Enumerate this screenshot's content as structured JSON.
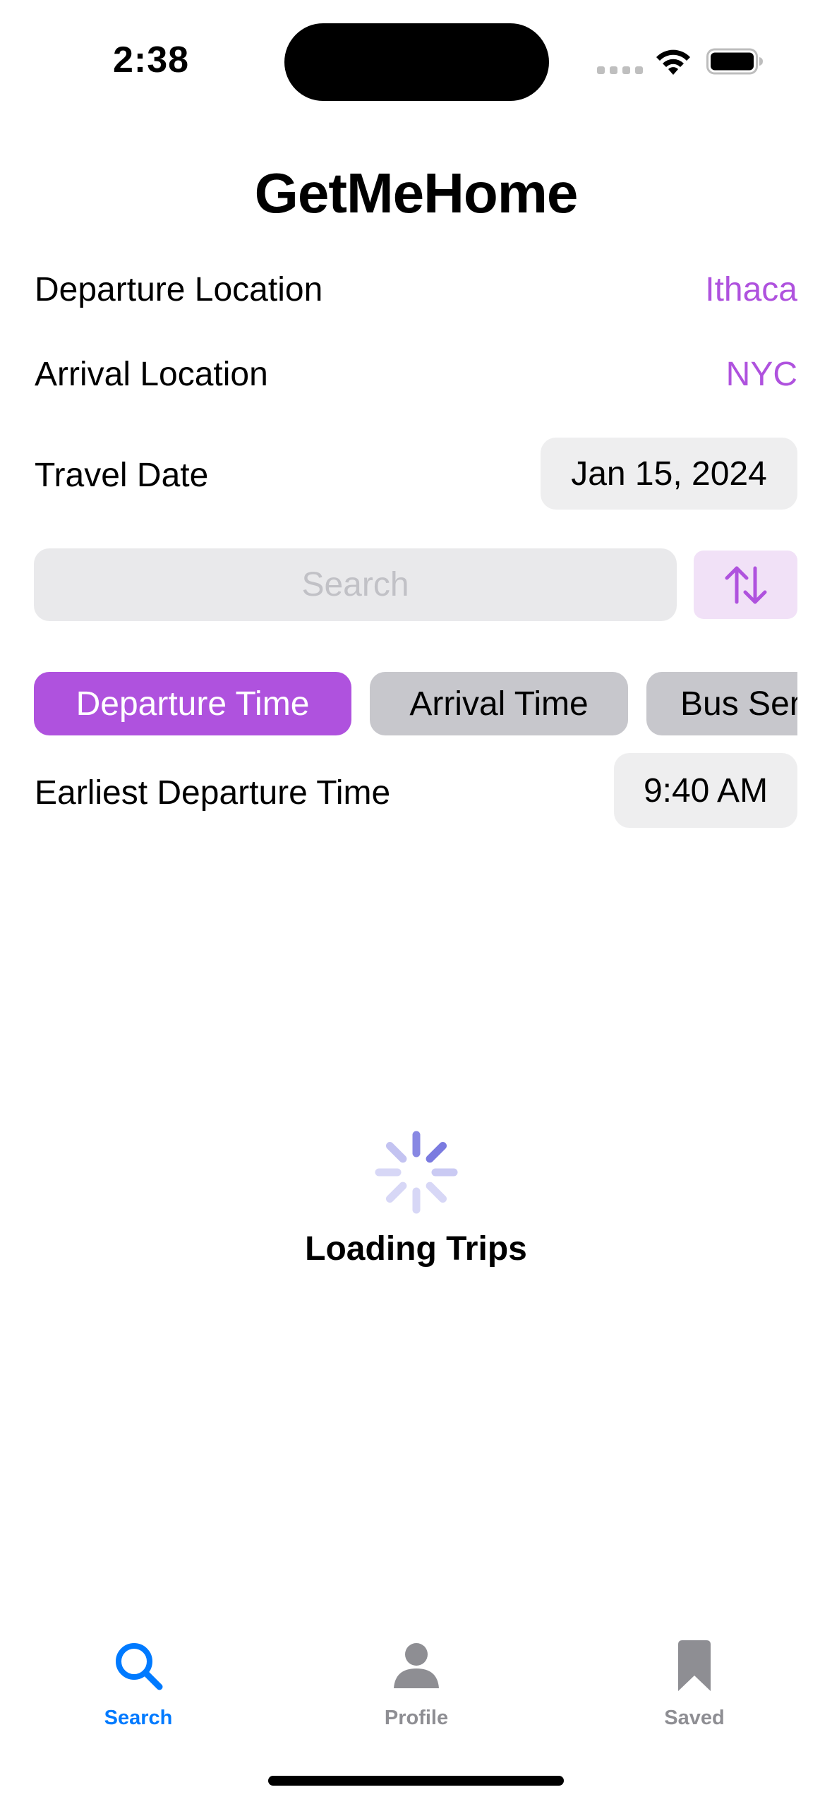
{
  "status_bar": {
    "time": "2:38"
  },
  "app": {
    "title": "GetMeHome"
  },
  "form": {
    "departure": {
      "label": "Departure Location",
      "value": "Ithaca"
    },
    "arrival": {
      "label": "Arrival Location",
      "value": "NYC"
    },
    "travel_date": {
      "label": "Travel Date",
      "value": "Jan 15, 2024"
    },
    "search_placeholder": "Search",
    "swap_icon": "swap-vertical-arrows-icon"
  },
  "sort_tabs": [
    {
      "label": "Departure Time",
      "active": true
    },
    {
      "label": "Arrival Time",
      "active": false
    },
    {
      "label": "Bus Ser",
      "active": false
    }
  ],
  "earliest_departure": {
    "label": "Earliest Departure Time",
    "value": "9:40 AM"
  },
  "loading": {
    "text": "Loading Trips"
  },
  "tab_bar": {
    "items": [
      {
        "label": "Search",
        "icon": "magnifier-icon",
        "selected": true
      },
      {
        "label": "Profile",
        "icon": "person-icon",
        "selected": false
      },
      {
        "label": "Saved",
        "icon": "bookmark-icon",
        "selected": false
      }
    ]
  },
  "colors": {
    "accent": "#af52de",
    "tab_selected": "#007aff",
    "tab_unselected": "#8e8e93",
    "spinner": "#7b7be0"
  }
}
